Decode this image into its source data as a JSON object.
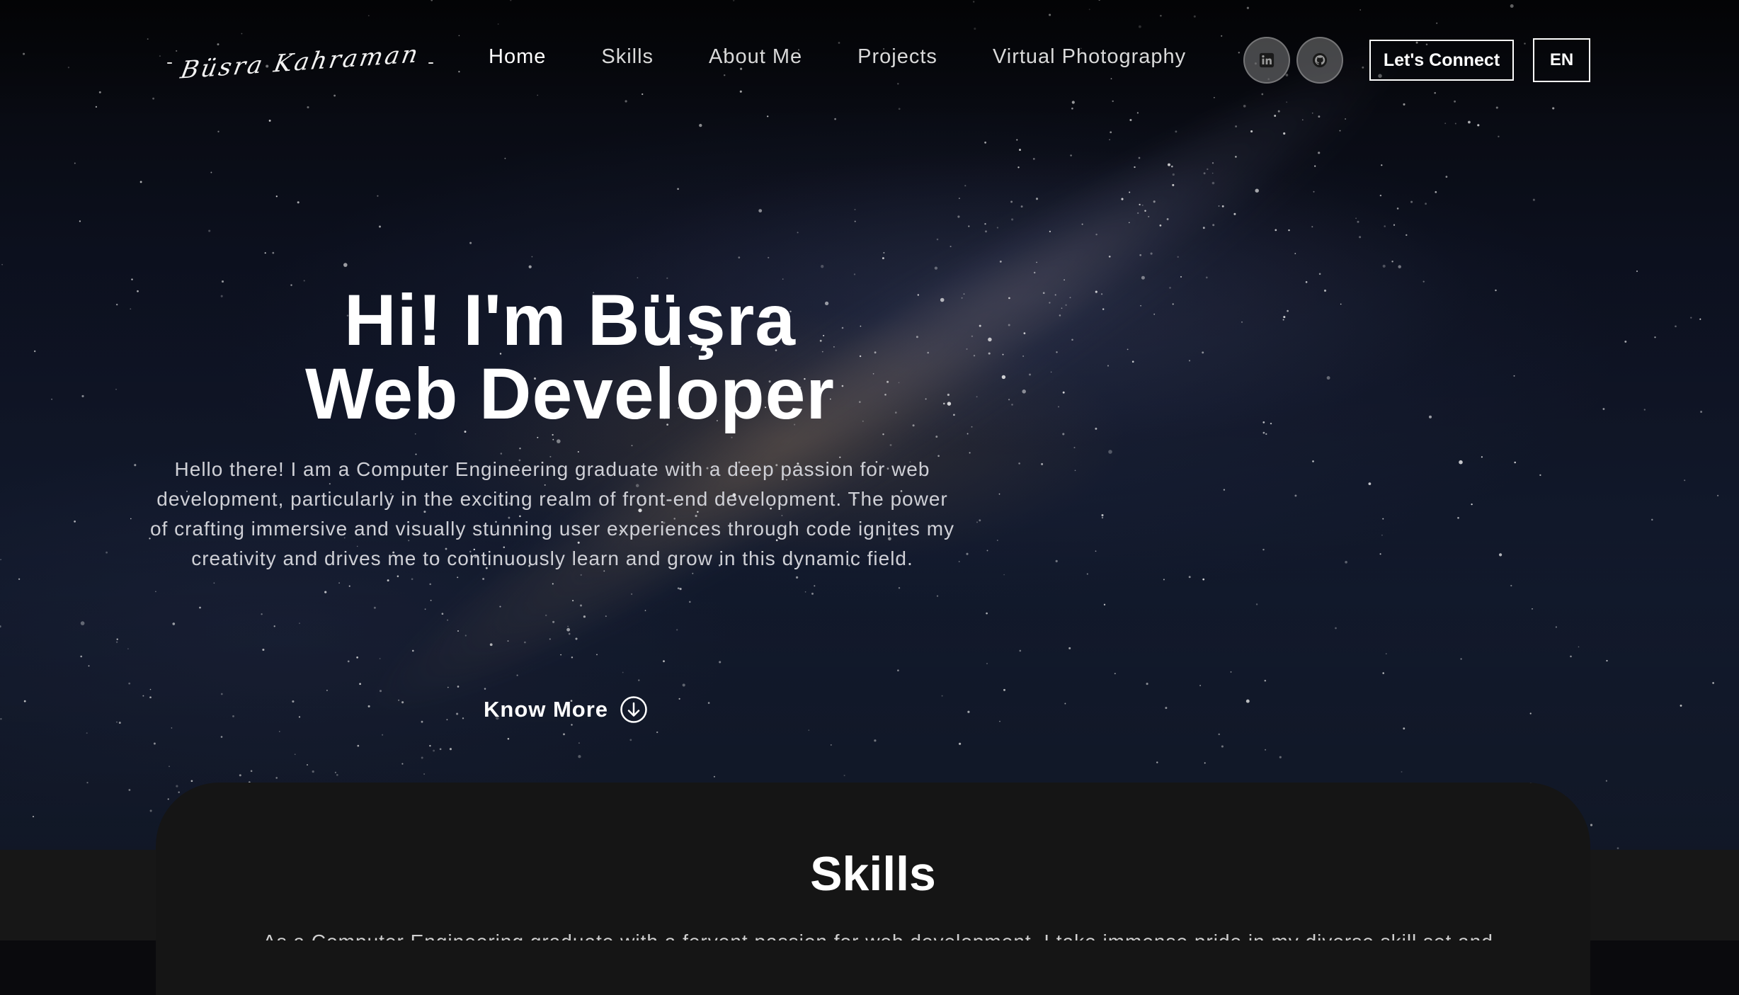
{
  "nav": {
    "logo_text": "Büsra Kahraman",
    "logo_dash": "-",
    "links": [
      {
        "label": "Home"
      },
      {
        "label": "Skills"
      },
      {
        "label": "About Me"
      },
      {
        "label": "Projects"
      },
      {
        "label": "Virtual Photography"
      }
    ],
    "connect_label": "Let's Connect",
    "language_label": "EN",
    "social_icons": [
      "linkedin-icon",
      "github-icon"
    ]
  },
  "hero": {
    "title_line1": "Hi! I'm Büşra",
    "title_line2": "Web Developer",
    "description": "Hello there! I am a Computer Engineering graduate with a deep passion for web development, particularly in the exciting realm of front-end development. The power of crafting immersive and visually stunning user experiences through code ignites my creativity and drives me to continuously learn and grow in this dynamic field.",
    "cta_label": "Know More"
  },
  "skills": {
    "title": "Skills",
    "description": "As a Computer Engineering graduate with a fervent passion for web development, I take immense pride in my diverse skill set and"
  },
  "colors": {
    "background_dark": "#0a0a0d",
    "section_dark": "#151515",
    "text_primary": "#ffffff",
    "text_muted": "#cfd0d6",
    "social_circle": "#7a7a7a"
  }
}
